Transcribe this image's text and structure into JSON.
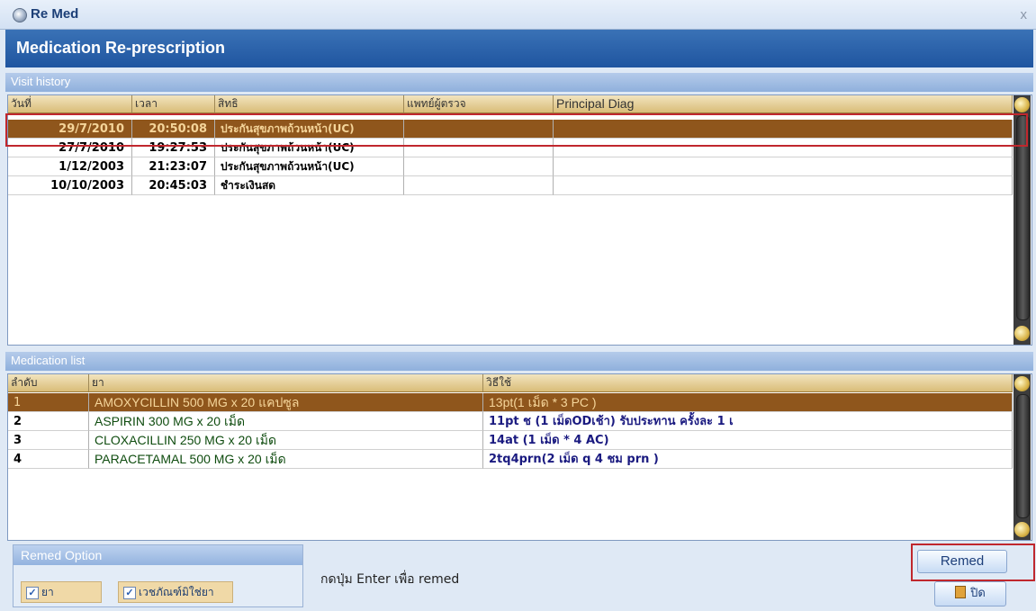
{
  "window": {
    "app_title": "Re Med",
    "close_icon": "close-icon"
  },
  "header": {
    "title": "Medication Re-prescription"
  },
  "visit_history": {
    "section_title": "Visit history",
    "columns": [
      "วันที่",
      "เวลา",
      "สิทธิ",
      "แพทย์ผู้ตรวจ",
      "Principal Diag"
    ],
    "rows": [
      {
        "date": "29/7/2010",
        "time": "20:50:08",
        "right": "ประกันสุขภาพถ้วนหน้า(UC)",
        "doctor": "",
        "diag": "",
        "selected": true
      },
      {
        "date": "27/7/2010",
        "time": "19:27:53",
        "right": "ประกันสุขภาพถ้วนหน้า(UC)",
        "doctor": "",
        "diag": "",
        "selected": false
      },
      {
        "date": "1/12/2003",
        "time": "21:23:07",
        "right": "ประกันสุขภาพถ้วนหน้า(UC)",
        "doctor": "",
        "diag": "",
        "selected": false
      },
      {
        "date": "10/10/2003",
        "time": "20:45:03",
        "right": "ชำระเงินสด",
        "doctor": "",
        "diag": "",
        "selected": false
      }
    ]
  },
  "medication_list": {
    "section_title": "Medication list",
    "columns": [
      "ลำดับ",
      "ยา",
      "วิธีใช้"
    ],
    "rows": [
      {
        "no": "1",
        "drug": "AMOXYCILLIN 500 MG x 20 แคปซูล",
        "usage": "13pt(1 เม็ด * 3 PC )",
        "selected": true
      },
      {
        "no": "2",
        "drug": "ASPIRIN 300 MG x 20 เม็ด",
        "usage": "11pt ช (1 เม็ดODเช้า) รับประทาน ครั้งละ   1    เ",
        "selected": false
      },
      {
        "no": "3",
        "drug": "CLOXACILLIN 250 MG x 20 เม็ด",
        "usage": "14at (1 เม็ด * 4 AC)",
        "selected": false
      },
      {
        "no": "4",
        "drug": "PARACETAMAL 500 MG x 20 เม็ด",
        "usage": "2tq4prn(2 เม็ด q 4 ชม prn )",
        "selected": false
      }
    ]
  },
  "remed_option": {
    "title": "Remed Option",
    "drug_checkbox": {
      "label": "ยา",
      "checked": true
    },
    "supply_checkbox": {
      "label": "เวชภัณฑ์มิใช่ยา",
      "checked": true
    }
  },
  "hint_text": "กดปุ่ม Enter เพื่อ remed",
  "buttons": {
    "remed": "Remed",
    "close": "ปิด"
  }
}
